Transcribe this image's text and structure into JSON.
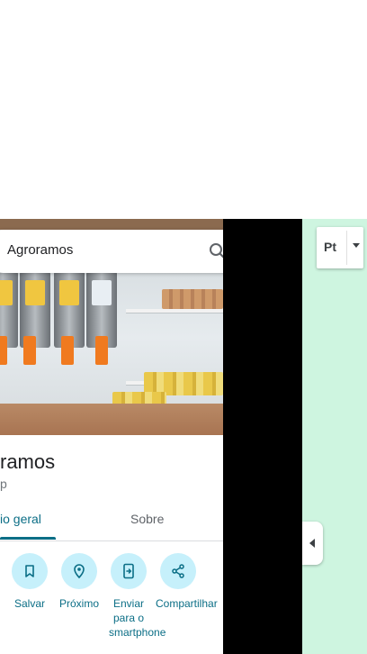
{
  "search": {
    "query": "Agroramos"
  },
  "place": {
    "title": "ramos",
    "subtitle": "p"
  },
  "tabs": [
    {
      "label": "io geral",
      "selected": true
    },
    {
      "label": "Sobre",
      "selected": false
    }
  ],
  "actions": [
    {
      "label": "Salvar",
      "icon": "bookmark-icon"
    },
    {
      "label": "Próximo",
      "icon": "nearby-icon"
    },
    {
      "label": "Enviar para o smartphone",
      "icon": "send-to-phone-icon"
    },
    {
      "label": "Compartilhar",
      "icon": "share-icon"
    }
  ],
  "map": {
    "layer_button_label": "Pt"
  },
  "colors": {
    "accent": "#0b6e86",
    "action_circle": "#c6f0fb",
    "map_green": "#cef5e0"
  }
}
